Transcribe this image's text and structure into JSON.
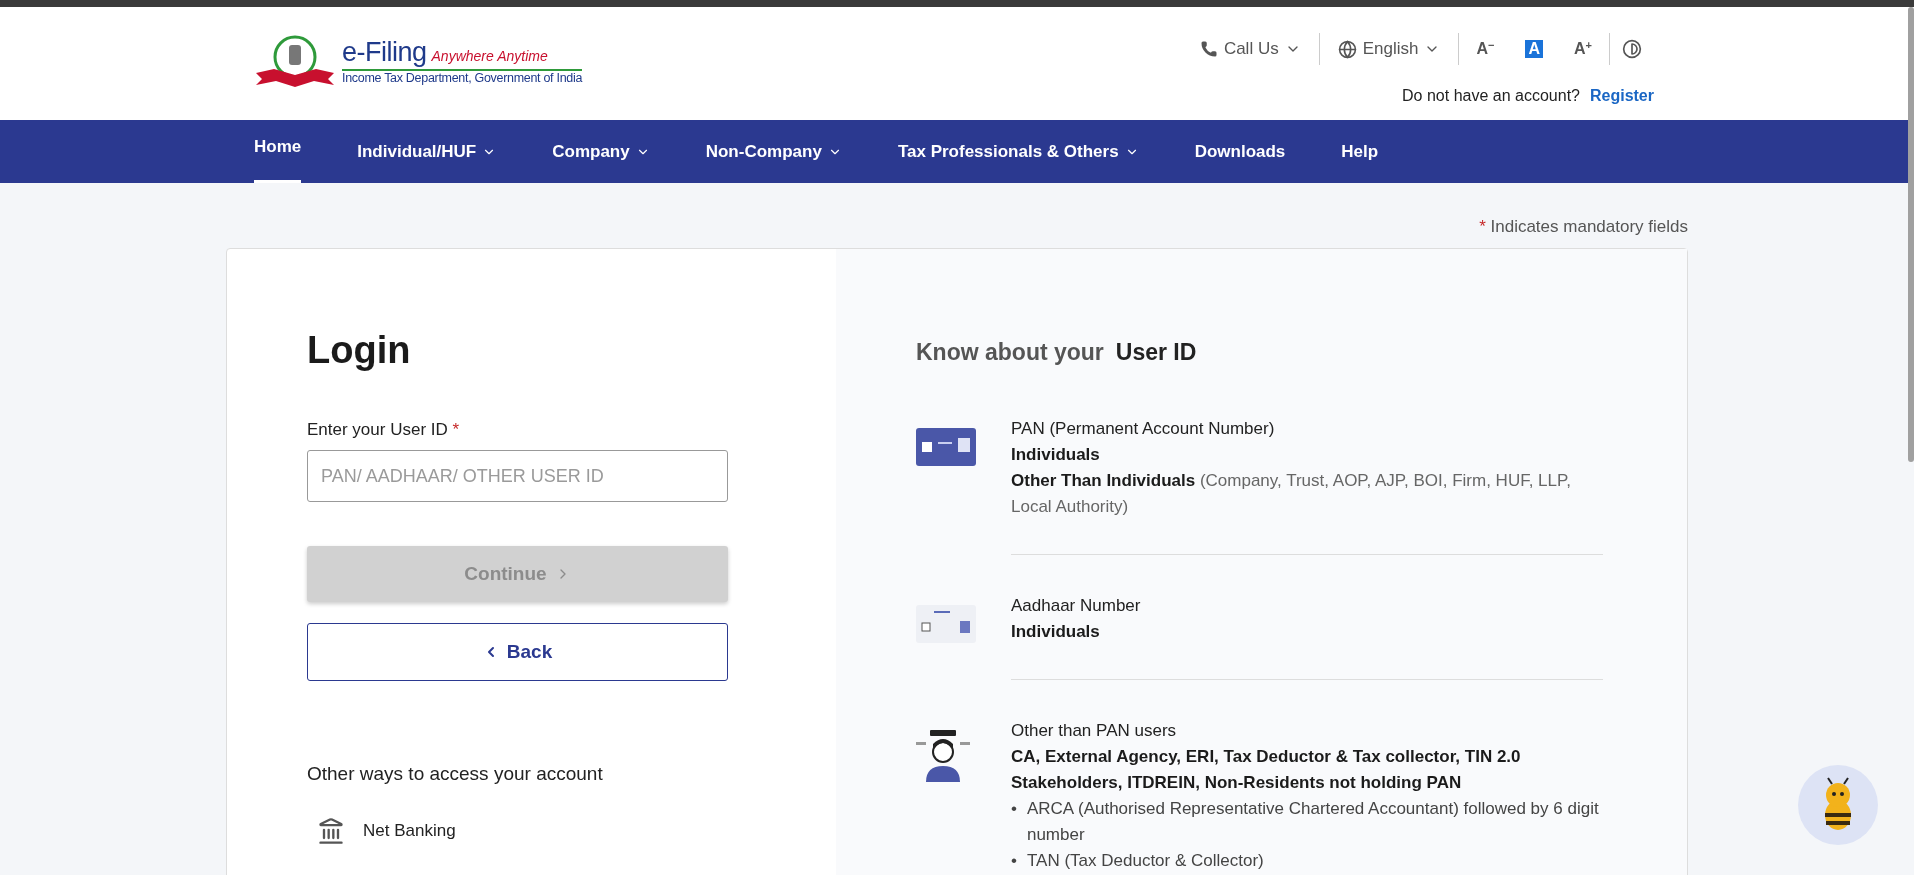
{
  "header": {
    "logo": {
      "title": "e-Filing",
      "tagline": "Anywhere Anytime",
      "subtitle": "Income Tax Department, Government of India"
    },
    "call_us": "Call Us",
    "language": "English",
    "font_sizes": [
      {
        "label": "A",
        "sign": "−",
        "selected": false
      },
      {
        "label": "A",
        "selected": true
      },
      {
        "label": "A",
        "sign": "+",
        "selected": false
      }
    ],
    "account_prompt": "Do not have an account?",
    "register": "Register"
  },
  "nav": [
    {
      "label": "Home",
      "selected": true,
      "dropdown": false
    },
    {
      "label": "Individual/HUF",
      "selected": false,
      "dropdown": true
    },
    {
      "label": "Company",
      "selected": false,
      "dropdown": true
    },
    {
      "label": "Non-Company",
      "selected": false,
      "dropdown": true
    },
    {
      "label": "Tax Professionals & Others",
      "selected": false,
      "dropdown": true
    },
    {
      "label": "Downloads",
      "selected": false,
      "dropdown": false
    },
    {
      "label": "Help",
      "selected": false,
      "dropdown": false
    }
  ],
  "mandatory_note": {
    "mark": "*",
    "text": "Indicates mandatory fields"
  },
  "login": {
    "title": "Login",
    "field_label": "Enter your User ID",
    "required_mark": "*",
    "placeholder": "PAN/ AADHAAR/ OTHER USER ID",
    "continue": {
      "label": "Continue",
      "disabled": true
    },
    "back": "Back",
    "other_ways_title": "Other ways to access your account",
    "other_ways": [
      {
        "label": "Net Banking"
      }
    ]
  },
  "info": {
    "heading_prefix": "Know about your",
    "heading_emphasis": "User ID",
    "items": [
      {
        "kind": "pan",
        "title": "PAN (Permanent Account Number)",
        "lines": [
          "**Individuals**",
          "**Other Than Individuals** (Company, Trust, AOP, AJP, BOI, Firm, HUF, LLP, Local Authority)"
        ]
      },
      {
        "kind": "aadhaar",
        "title": "Aadhaar Number",
        "lines": [
          "**Individuals**"
        ]
      },
      {
        "kind": "other",
        "title": "Other than PAN users",
        "lines": [
          "**CA, External Agency, ERI, Tax Deductor & Tax collector, TIN 2.0 Stakeholders, ITDREIN, Non-Residents not holding PAN**"
        ],
        "bullets": [
          {
            "mark": "•",
            "text": "ARCA (Authorised Representative Chartered Accountant) followed by 6 digit number"
          },
          {
            "mark": "•",
            "text": "TAN (Tax Deductor & Collector)"
          }
        ]
      }
    ]
  }
}
